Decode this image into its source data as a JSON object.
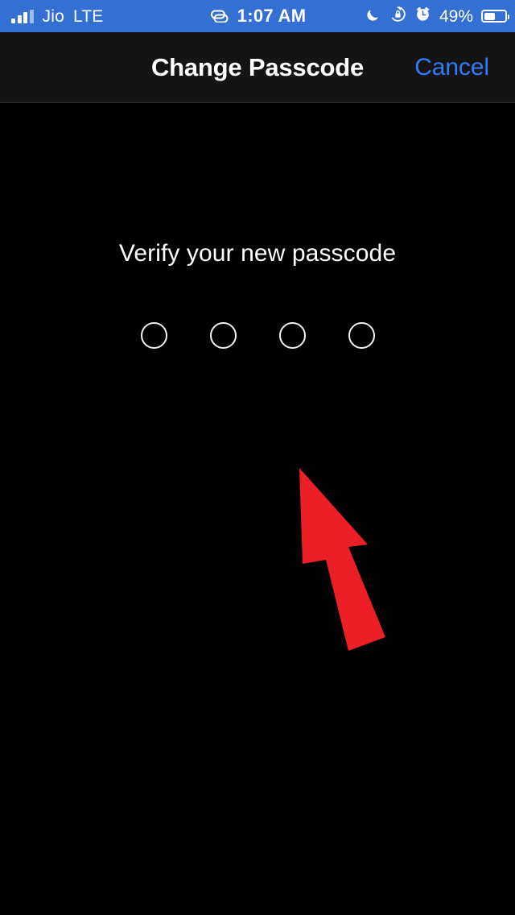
{
  "status_bar": {
    "carrier": "Jio",
    "network_type": "LTE",
    "time": "1:07 AM",
    "battery_percent": "49%",
    "battery_level": 49,
    "signal_bars_filled": 3,
    "signal_bars_total": 4,
    "background_color": "#3470D4",
    "foreground_color": "#FFFFFF",
    "icons": [
      "signal-bars-icon",
      "link-icon",
      "moon-icon",
      "rotation-lock-icon",
      "alarm-clock-icon",
      "battery-icon"
    ]
  },
  "nav_bar": {
    "title": "Change Passcode",
    "cancel_label": "Cancel",
    "background_color": "#141414",
    "title_color": "#FFFFFF",
    "accent_color": "#2F7CF6"
  },
  "content": {
    "prompt": "Verify your new passcode",
    "prompt_color": "#FFFFFF",
    "background_color": "#000000",
    "passcode": {
      "length": 4,
      "entered": 0,
      "dots": [
        {
          "name": "passcode-dot-1",
          "filled": false
        },
        {
          "name": "passcode-dot-2",
          "filled": false
        },
        {
          "name": "passcode-dot-3",
          "filled": false
        },
        {
          "name": "passcode-dot-4",
          "filled": false
        }
      ]
    }
  },
  "annotation": {
    "type": "arrow",
    "color": "#ED1F26",
    "direction": "up-left",
    "points_to": "passcode-dot-3"
  }
}
